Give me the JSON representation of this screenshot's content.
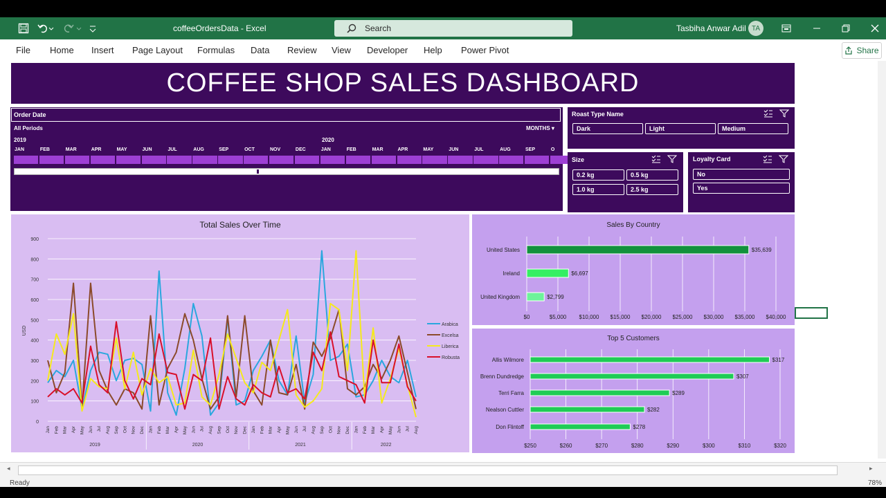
{
  "window": {
    "file_title": "coffeeOrdersData - Excel",
    "search_placeholder": "Search",
    "user_name": "Tasbiha Anwar Adil",
    "user_initials": "TA"
  },
  "ribbon": {
    "tabs": [
      "File",
      "Home",
      "Insert",
      "Page Layout",
      "Formulas",
      "Data",
      "Review",
      "View",
      "Developer",
      "Help",
      "Power Pivot"
    ],
    "share_label": "Share"
  },
  "dashboard": {
    "title": "COFFEE SHOP SALES DASHBOARD"
  },
  "timeline": {
    "header": "Order Date",
    "period": "All Periods",
    "unit": "MONTHS",
    "years": [
      "2019",
      "2020"
    ],
    "months": [
      "JAN",
      "FEB",
      "MAR",
      "APR",
      "MAY",
      "JUN",
      "JUL",
      "AUG",
      "SEP",
      "OCT",
      "NOV",
      "DEC",
      "JAN",
      "FEB",
      "MAR",
      "APR",
      "MAY",
      "JUN",
      "JUL",
      "AUG",
      "SEP",
      "O"
    ]
  },
  "slicers": {
    "roast": {
      "header": "Roast Type Name",
      "items": [
        "Dark",
        "Light",
        "Medium"
      ]
    },
    "size": {
      "header": "Size",
      "items": [
        "0.2 kg",
        "0.5 kg",
        "1.0 kg",
        "2.5 kg"
      ]
    },
    "loyalty": {
      "header": "Loyalty Card",
      "items": [
        "No",
        "Yes"
      ]
    }
  },
  "colors": {
    "header_bg": "#3d0a5c",
    "excel_green": "#217346",
    "chart_bg": "#d9bdf2",
    "arabica": "#2aa7de",
    "excelsa": "#8b4a2a",
    "liberica": "#f5ea1c",
    "robusta": "#d90f2a",
    "bar_us": "#12913c",
    "bar_ie": "#35ef63",
    "bar_uk": "#6df39a",
    "bar_cust": "#1fcc55"
  },
  "icons": [
    "save-icon",
    "undo-icon",
    "redo-icon",
    "customize-icon",
    "search-icon",
    "ribbon-display-icon",
    "minimize-icon",
    "restore-icon",
    "close-icon",
    "share-icon",
    "multiselect-icon",
    "clear-filter-icon"
  ],
  "status": {
    "ready": "Ready",
    "zoom": "78%"
  },
  "chart_data": [
    {
      "type": "line",
      "title": "Total Sales Over Time",
      "ylabel": "USD",
      "ylim": [
        0,
        900
      ],
      "yticks": [
        0,
        100,
        200,
        300,
        400,
        500,
        600,
        700,
        800,
        900
      ],
      "x": [
        "Jan",
        "Feb",
        "Mar",
        "Apr",
        "May",
        "Jun",
        "Jul",
        "Aug",
        "Sep",
        "Oct",
        "Nov",
        "Dec",
        "Jan",
        "Feb",
        "Mar",
        "Apr",
        "May",
        "Jun",
        "Jul",
        "Aug",
        "Sep",
        "Oct",
        "Nov",
        "Dec",
        "Jan",
        "Feb",
        "Mar",
        "Apr",
        "May",
        "Jun",
        "Jul",
        "Aug",
        "Sep",
        "Oct",
        "Nov",
        "Dec",
        "Jan",
        "Feb",
        "Mar",
        "Apr",
        "May",
        "Jun",
        "Jul",
        "Aug"
      ],
      "year_groups": [
        {
          "label": "2019",
          "start": 0,
          "end": 11
        },
        {
          "label": "2020",
          "start": 12,
          "end": 23
        },
        {
          "label": "2021",
          "start": 24,
          "end": 35
        },
        {
          "label": "2022",
          "start": 36,
          "end": 43
        }
      ],
      "legend_position": "right",
      "series": [
        {
          "name": "Arabica",
          "values": [
            190,
            250,
            220,
            300,
            60,
            250,
            340,
            330,
            200,
            300,
            310,
            280,
            50,
            740,
            140,
            30,
            260,
            580,
            420,
            30,
            90,
            510,
            80,
            100,
            250,
            320,
            400,
            200,
            130,
            420,
            90,
            230,
            840,
            300,
            320,
            380,
            120,
            130,
            200,
            300,
            220,
            190,
            300,
            120
          ]
        },
        {
          "name": "Excelsa",
          "values": [
            300,
            140,
            240,
            680,
            70,
            680,
            250,
            150,
            80,
            160,
            140,
            60,
            520,
            80,
            260,
            340,
            530,
            400,
            210,
            60,
            120,
            520,
            120,
            520,
            150,
            80,
            400,
            140,
            130,
            280,
            60,
            390,
            320,
            410,
            550,
            160,
            130,
            170,
            280,
            210,
            300,
            420,
            240,
            60
          ]
        },
        {
          "name": "Liberica",
          "values": [
            200,
            430,
            330,
            530,
            50,
            210,
            170,
            160,
            410,
            160,
            340,
            130,
            260,
            190,
            220,
            80,
            90,
            350,
            120,
            80,
            230,
            430,
            310,
            190,
            140,
            290,
            250,
            400,
            550,
            130,
            70,
            100,
            160,
            580,
            550,
            250,
            840,
            120,
            460,
            90,
            210,
            360,
            180,
            20
          ]
        },
        {
          "name": "Robusta",
          "values": [
            120,
            160,
            130,
            160,
            90,
            370,
            180,
            140,
            490,
            200,
            110,
            210,
            180,
            430,
            240,
            230,
            60,
            230,
            200,
            410,
            60,
            220,
            110,
            80,
            180,
            140,
            120,
            270,
            140,
            160,
            110,
            340,
            250,
            440,
            220,
            200,
            180,
            90,
            400,
            190,
            190,
            380,
            170,
            100
          ]
        }
      ]
    },
    {
      "type": "bar",
      "title": "Sales By Country",
      "categories": [
        "United States",
        "Ireland",
        "United Kingdom"
      ],
      "values": [
        35639,
        6697,
        2799
      ],
      "value_labels": [
        "$35,639",
        "$6,697",
        "$2,799"
      ],
      "xlim": [
        0,
        40000
      ],
      "xticks": [
        "$0",
        "$5,000",
        "$10,000",
        "$15,000",
        "$20,000",
        "$25,000",
        "$30,000",
        "$35,000",
        "$40,000"
      ]
    },
    {
      "type": "bar",
      "title": "Top 5 Customers",
      "categories": [
        "Allis Wilmore",
        "Brenn Dundredge",
        "Terri Farra",
        "Nealson Cuttler",
        "Don Flintoff"
      ],
      "values": [
        317,
        307,
        289,
        282,
        278
      ],
      "value_labels": [
        "$317",
        "$307",
        "$289",
        "$282",
        "$278"
      ],
      "xlim": [
        250,
        320
      ],
      "xticks": [
        "$250",
        "$260",
        "$270",
        "$280",
        "$290",
        "$300",
        "$310",
        "$320"
      ]
    }
  ]
}
